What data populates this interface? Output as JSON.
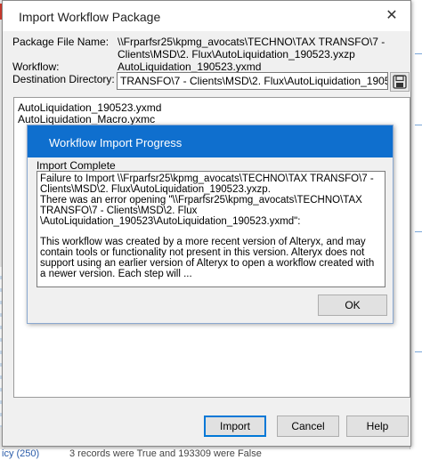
{
  "background": {
    "bottom_left_text": "icy (250)",
    "bottom_right_text": "3 records were True and 193309 were False"
  },
  "dialog": {
    "title": "Import Workflow Package",
    "package_file_label": "Package File Name:",
    "package_file_value": "\\\\Frparfsr25\\kpmg_avocats\\TECHNO\\TAX TRANSFO\\7 - Clients\\MSD\\2. Flux\\AutoLiquidation_190523.yxzp",
    "workflow_label": "Workflow:",
    "workflow_value": "AutoLiquidation_190523.yxmd",
    "destination_label": "Destination Directory:",
    "destination_value": "TRANSFO\\7 - Clients\\MSD\\2. Flux\\AutoLiquidation_190523",
    "files": [
      "AutoLiquidation_190523.yxmd",
      "AutoLiquidation_Macro.yxmc"
    ],
    "import_button": "Import",
    "cancel_button": "Cancel",
    "help_button": "Help"
  },
  "progress": {
    "title": "Workflow Import Progress",
    "status": "Import Complete",
    "message": "Failure to Import \\\\Frparfsr25\\kpmg_avocats\\TECHNO\\TAX TRANSFO\\7 - Clients\\MSD\\2. Flux\\AutoLiquidation_190523.yxzp.\nThere was an error opening \"\\\\Frparfsr25\\kpmg_avocats\\TECHNO\\TAX TRANSFO\\7 - Clients\\MSD\\2. Flux \\AutoLiquidation_190523\\AutoLiquidation_190523.yxmd\":\n\nThis workflow was created by a more recent version of Alteryx, and may contain tools or functionality not present in this version. Alteryx does not support using an earlier version of Alteryx to open a workflow created with a newer version. Each step will ...",
    "ok_button": "OK"
  },
  "colors": {
    "accent": "#0f6fce",
    "default_button_border": "#0078d7"
  }
}
